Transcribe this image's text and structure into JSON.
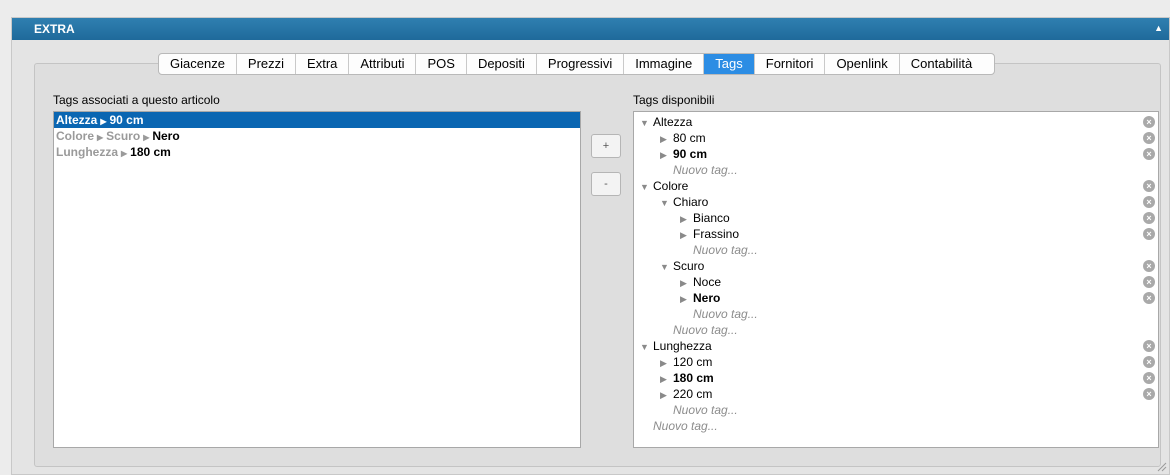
{
  "panel": {
    "title": "EXTRA",
    "collapse_glyph": "▲"
  },
  "tabs": [
    {
      "label": "Giacenze"
    },
    {
      "label": "Prezzi"
    },
    {
      "label": "Extra"
    },
    {
      "label": "Attributi"
    },
    {
      "label": "POS"
    },
    {
      "label": "Depositi"
    },
    {
      "label": "Progressivi"
    },
    {
      "label": "Immagine"
    },
    {
      "label": "Tags",
      "active": true
    },
    {
      "label": "Fornitori"
    },
    {
      "label": "Openlink"
    },
    {
      "label": "Contabilità"
    }
  ],
  "associated": {
    "label": "Tags associati a questo articolo",
    "rows": [
      {
        "parts": [
          "Altezza",
          "90 cm"
        ]
      },
      {
        "parts": [
          "Colore",
          "Scuro",
          "Nero"
        ]
      },
      {
        "parts": [
          "Lunghezza",
          "180 cm"
        ]
      }
    ]
  },
  "buttons": {
    "add": "+",
    "remove": "-"
  },
  "available": {
    "label": "Tags disponibili",
    "tree": [
      {
        "text": "Altezza",
        "level": 0,
        "kind": "open",
        "removable": true
      },
      {
        "text": "80 cm",
        "level": 1,
        "kind": "closed",
        "removable": true
      },
      {
        "text": "90 cm",
        "level": 1,
        "kind": "closed",
        "removable": true,
        "bold": true
      },
      {
        "text": "Nuovo tag...",
        "level": 1,
        "kind": "new"
      },
      {
        "text": "Colore",
        "level": 0,
        "kind": "open",
        "removable": true
      },
      {
        "text": "Chiaro",
        "level": 1,
        "kind": "open",
        "removable": true
      },
      {
        "text": "Bianco",
        "level": 2,
        "kind": "closed",
        "removable": true
      },
      {
        "text": "Frassino",
        "level": 2,
        "kind": "closed",
        "removable": true
      },
      {
        "text": "Nuovo tag...",
        "level": 2,
        "kind": "new"
      },
      {
        "text": "Scuro",
        "level": 1,
        "kind": "open",
        "removable": true
      },
      {
        "text": "Noce",
        "level": 2,
        "kind": "closed",
        "removable": true
      },
      {
        "text": "Nero",
        "level": 2,
        "kind": "closed",
        "removable": true,
        "bold": true
      },
      {
        "text": "Nuovo tag...",
        "level": 2,
        "kind": "new"
      },
      {
        "text": "Nuovo tag...",
        "level": 1,
        "kind": "new"
      },
      {
        "text": "Lunghezza",
        "level": 0,
        "kind": "open",
        "removable": true
      },
      {
        "text": "120 cm",
        "level": 1,
        "kind": "closed",
        "removable": true
      },
      {
        "text": "180 cm",
        "level": 1,
        "kind": "closed",
        "removable": true,
        "bold": true
      },
      {
        "text": "220 cm",
        "level": 1,
        "kind": "closed",
        "removable": true
      },
      {
        "text": "Nuovo tag...",
        "level": 1,
        "kind": "new"
      },
      {
        "text": "Nuovo tag...",
        "level": 0,
        "kind": "new"
      }
    ]
  },
  "colors": {
    "header": "#1f6a9b",
    "active_tab": "#2c8de4",
    "selection": "#0a66b2"
  }
}
